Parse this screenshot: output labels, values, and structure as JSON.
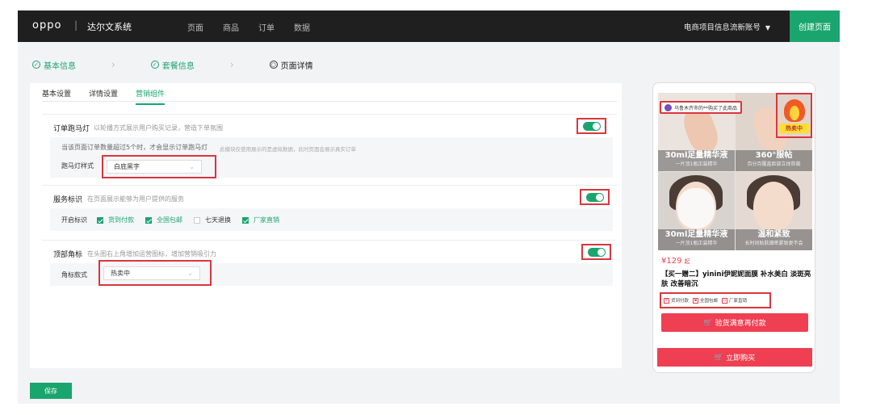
{
  "topnav": {
    "brand": "oppo",
    "separator": "|",
    "system_name": "达尔文系统",
    "items": [
      "页面",
      "商品",
      "订单",
      "数据"
    ],
    "account": "电商项目信息流新账号",
    "create_label": "创建页面"
  },
  "steps": [
    {
      "label": "基本信息",
      "icon": "✓",
      "state": "done"
    },
    {
      "label": "套餐信息",
      "icon": "✓",
      "state": "done"
    },
    {
      "label": "页面详情",
      "icon": "○",
      "state": "active"
    }
  ],
  "tabs": [
    {
      "label": "基本设置",
      "active": false
    },
    {
      "label": "详情设置",
      "active": false
    },
    {
      "label": "营销组件",
      "active": true
    }
  ],
  "sections": {
    "marquee": {
      "title": "订单跑马灯",
      "desc": "以轮播方式展示用户购买记录，营造下单氛围",
      "enabled": true,
      "hint": "当该页面订单数量超过5个时，才会显示订单跑马灯",
      "hint_small": "此模块仅使用展示的是虚拟数据，此时页面会展示真实订单",
      "field_label": "跑马灯样式",
      "select_value": "白底黑字"
    },
    "service": {
      "title": "服务标识",
      "desc": "在页面展示能够为用户提供的服务",
      "enabled": true,
      "field_label": "开启标识",
      "options": [
        {
          "label": "货到付款",
          "checked": true
        },
        {
          "label": "全国包邮",
          "checked": true
        },
        {
          "label": "七天退换",
          "checked": false
        },
        {
          "label": "厂家直销",
          "checked": true
        }
      ]
    },
    "corner": {
      "title": "顶部角标",
      "desc": "在头图右上角增加运营图标，增加营销吸引力",
      "enabled": true,
      "field_label": "角标款式",
      "select_value": "热卖中"
    }
  },
  "save_label": "保存",
  "preview": {
    "sold_text": "乌鲁木齐市的**购买了此商品",
    "hot_label": "热卖中",
    "tiles": [
      {
        "big": "30ml足量精华液",
        "small": "一片顶1瓶正装精华"
      },
      {
        "big": "360°服帖",
        "small": "百分百覆盖脸部立体剪裁"
      },
      {
        "big": "30ml足量精华液",
        "small": "一片顶1瓶正装精华"
      },
      {
        "big": "温和紧致",
        "small": "长时间贴肤细密紧致更不会"
      }
    ],
    "price": "¥129",
    "price_unit": "起",
    "product_title": "【买一赠二】yinini伊妮妮面膜 补水美白 淡斑亮肤 改善暗沉",
    "services": [
      "货到付款",
      "全国包邮",
      "厂家直销"
    ],
    "buy_primary": "验货满意再付款",
    "buy_secondary": "立即购买"
  },
  "colors": {
    "accent": "#1aa56e",
    "highlight": "#d9363e",
    "buy": "#ef3f52"
  }
}
